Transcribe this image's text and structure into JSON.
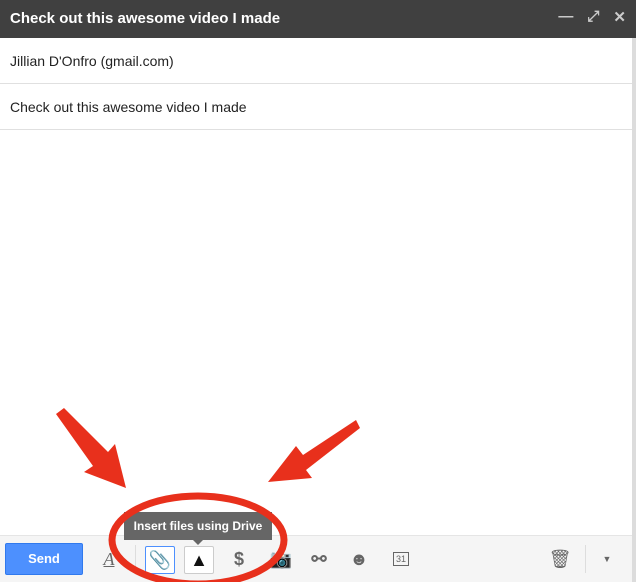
{
  "window": {
    "title": "Check out this awesome video I made",
    "icons": [
      "minimize-icon",
      "fullscreen-icon",
      "close-icon"
    ]
  },
  "fields": {
    "to": "Jillian D'Onfro (gmail.com)",
    "subject": "Check out this awesome video I made"
  },
  "toolbar": {
    "send_label": "Send",
    "calendar_day": "31",
    "tooltip": "Insert files using Drive"
  },
  "colors": {
    "header": "#404040",
    "send": "#4d90fe",
    "annotation": "#e8301c"
  }
}
